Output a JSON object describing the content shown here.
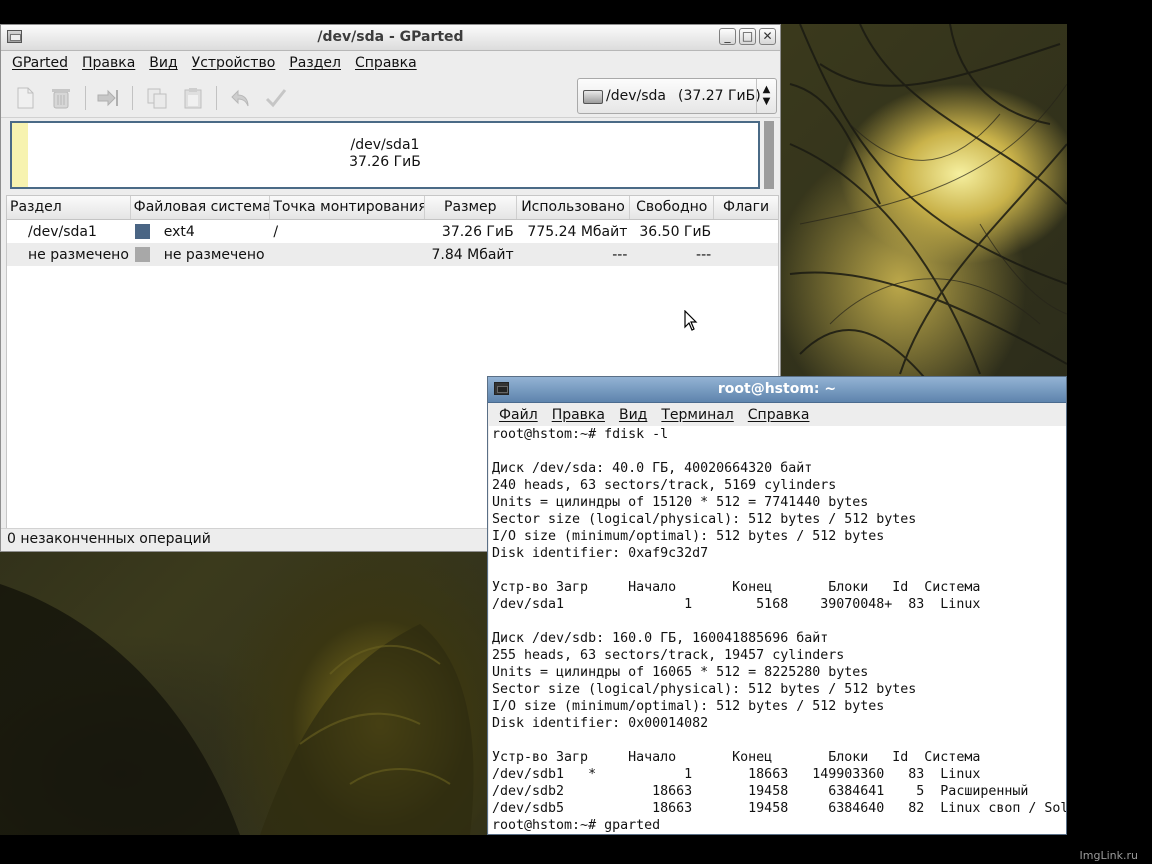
{
  "watermark": "ImgLink.ru",
  "gparted": {
    "title": "/dev/sda - GParted",
    "menu": [
      "GParted",
      "Правка",
      "Вид",
      "Устройство",
      "Раздел",
      "Справка"
    ],
    "toolbar_icons": [
      "new-icon",
      "delete-icon",
      "resize-move-icon",
      "copy-icon",
      "paste-icon",
      "undo-icon",
      "apply-icon"
    ],
    "device_selector": {
      "name": "/dev/sda",
      "size": "(37.27 ГиБ)"
    },
    "disk_map": {
      "name": "/dev/sda1",
      "size": "37.26 ГиБ"
    },
    "table": {
      "headers": [
        "Раздел",
        "Файловая система",
        "Точка монтирования",
        "Размер",
        "Использовано",
        "Свободно",
        "Флаги"
      ],
      "rows": [
        {
          "partition": "/dev/sda1",
          "fs": "ext4",
          "fs_color": "#4a6584",
          "mount": "/",
          "size": "37.26 ГиБ",
          "used": "775.24 Мбайт",
          "free": "36.50 ГиБ",
          "flags": ""
        },
        {
          "partition": "не размечено",
          "fs": "не размечено",
          "fs_color": "#a8a8a8",
          "mount": "",
          "size": "7.84 Мбайт",
          "used": "---",
          "free": "---",
          "flags": ""
        }
      ]
    },
    "status": "0 незаконченных операций"
  },
  "terminal": {
    "title": "root@hstom: ~",
    "menu": [
      "Файл",
      "Правка",
      "Вид",
      "Терминал",
      "Справка"
    ],
    "lines": [
      "root@hstom:~# fdisk -l",
      "",
      "Диск /dev/sda: 40.0 ГБ, 40020664320 байт",
      "240 heads, 63 sectors/track, 5169 cylinders",
      "Units = цилиндры of 15120 * 512 = 7741440 bytes",
      "Sector size (logical/physical): 512 bytes / 512 bytes",
      "I/O size (minimum/optimal): 512 bytes / 512 bytes",
      "Disk identifier: 0xaf9c32d7",
      "",
      "Устр-во Загр     Начало       Конец       Блоки   Id  Система",
      "/dev/sda1               1        5168    39070048+  83  Linux",
      "",
      "Диск /dev/sdb: 160.0 ГБ, 160041885696 байт",
      "255 heads, 63 sectors/track, 19457 cylinders",
      "Units = цилиндры of 16065 * 512 = 8225280 bytes",
      "Sector size (logical/physical): 512 bytes / 512 bytes",
      "I/O size (minimum/optimal): 512 bytes / 512 bytes",
      "Disk identifier: 0x00014082",
      "",
      "Устр-во Загр     Начало       Конец       Блоки   Id  Система",
      "/dev/sdb1   *           1       18663   149903360   83  Linux",
      "/dev/sdb2           18663       19458     6384641    5  Расширенный",
      "/dev/sdb5           18663       19458     6384640   82  Linux своп / Sol",
      "root@hstom:~# gparted"
    ]
  }
}
